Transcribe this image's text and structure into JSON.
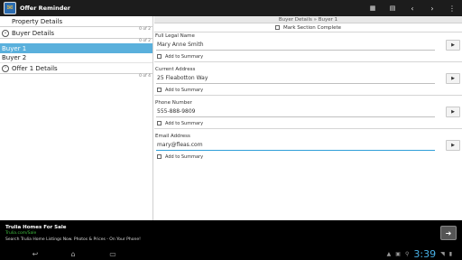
{
  "app": {
    "title": "Offer Reminder"
  },
  "action_bar": {
    "icons": [
      "calculator-icon",
      "edit-grid-icon",
      "previous-icon",
      "next-icon",
      "overflow-menu-icon"
    ]
  },
  "left_panel": {
    "property_header": "Property Details",
    "count1": "0 of 2",
    "buyer_header": "Buyer Details",
    "buyers": [
      "Buyer 1",
      "Buyer 2"
    ],
    "selected_buyer": "Buyer 1",
    "offer_header": "Offer 1 Details",
    "count2": "0 of 4"
  },
  "right_panel": {
    "breadcrumb": "Buyer Details » Buyer 1",
    "mark_complete_label": "Mark Section Complete",
    "add_to_summary_label": "Add to Summary",
    "fields": [
      {
        "label": "Full Legal Name",
        "value": "Mary Anne Smith"
      },
      {
        "label": "Current Address",
        "value": "25 Fleabotton Way"
      },
      {
        "label": "Phone Number",
        "value": "555-888-9809"
      },
      {
        "label": "Email Address",
        "value": "mary@fleas.com"
      }
    ]
  },
  "ad": {
    "title": "Trulia Homes For Sale",
    "url": "Trulia.com/Sale",
    "description": "Search Trulia Home Listings Now. Photos & Prices - On Your Phone!",
    "arrow": "➜"
  },
  "system_bar": {
    "clock": "3:39"
  }
}
